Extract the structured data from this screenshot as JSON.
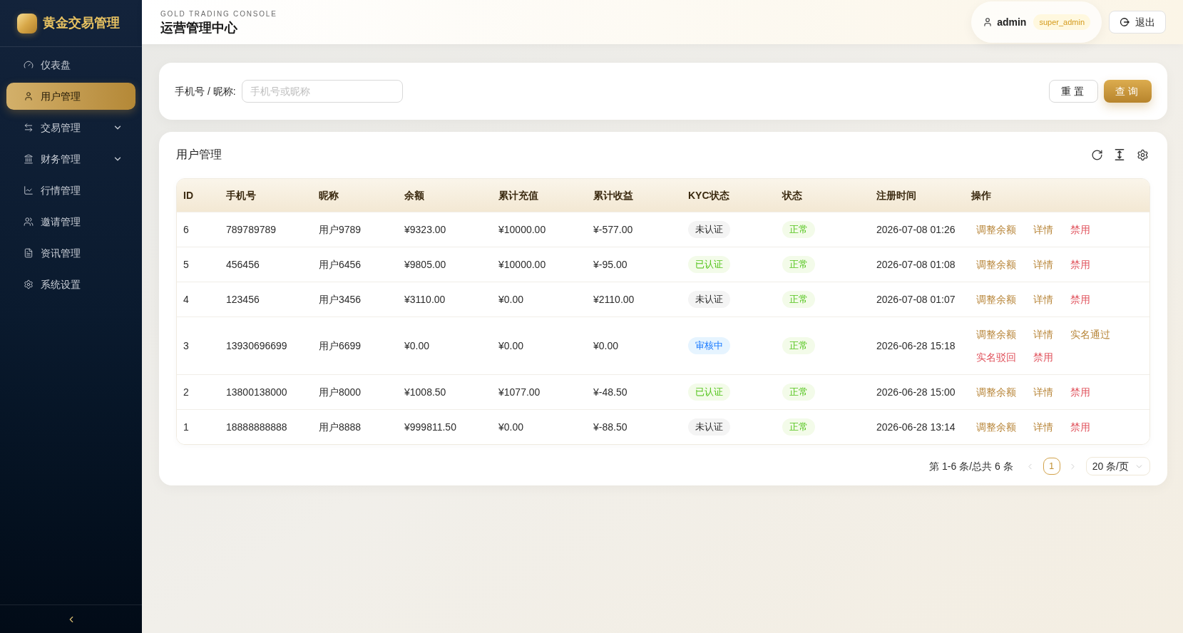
{
  "sidebar": {
    "title": "黄金交易管理",
    "items": [
      {
        "label": "仪表盘",
        "selected": false,
        "expandable": false
      },
      {
        "label": "用户管理",
        "selected": true,
        "expandable": false
      },
      {
        "label": "交易管理",
        "selected": false,
        "expandable": true
      },
      {
        "label": "财务管理",
        "selected": false,
        "expandable": true
      },
      {
        "label": "行情管理",
        "selected": false,
        "expandable": false
      },
      {
        "label": "邀请管理",
        "selected": false,
        "expandable": false
      },
      {
        "label": "资讯管理",
        "selected": false,
        "expandable": false
      },
      {
        "label": "系统设置",
        "selected": false,
        "expandable": false
      }
    ]
  },
  "header": {
    "subtitle": "GOLD TRADING CONSOLE",
    "title": "运营管理中心",
    "user": {
      "name": "admin",
      "role": "super_admin"
    },
    "logout": "退出"
  },
  "filter": {
    "label": "手机号 / 昵称:",
    "placeholder": "手机号或昵称",
    "buttons": [
      {
        "label": "重置",
        "primary": false
      },
      {
        "label": "查询",
        "primary": true
      }
    ]
  },
  "table": {
    "title": "用户管理",
    "columns": [
      "ID",
      "手机号",
      "昵称",
      "余额",
      "累计充值",
      "累计收益",
      "KYC状态",
      "状态",
      "注册时间",
      "操作"
    ],
    "rows": [
      {
        "id": "6",
        "phone": "789789789",
        "nickname": "用户9789",
        "balance": "¥9323.00",
        "total_recharge": "¥10000.00",
        "total_income": "¥-577.00",
        "kyc": {
          "label": "未认证",
          "kind": "unverified"
        },
        "status": {
          "label": "正常",
          "kind": "normal"
        },
        "registered_at": "2026-07-08 01:26",
        "actions": [
          {
            "label": "调整余额",
            "danger": false
          },
          {
            "label": "详情",
            "danger": false
          },
          {
            "label": "禁用",
            "danger": true
          }
        ]
      },
      {
        "id": "5",
        "phone": "456456",
        "nickname": "用户6456",
        "balance": "¥9805.00",
        "total_recharge": "¥10000.00",
        "total_income": "¥-95.00",
        "kyc": {
          "label": "已认证",
          "kind": "verified"
        },
        "status": {
          "label": "正常",
          "kind": "normal"
        },
        "registered_at": "2026-07-08 01:08",
        "actions": [
          {
            "label": "调整余额",
            "danger": false
          },
          {
            "label": "详情",
            "danger": false
          },
          {
            "label": "禁用",
            "danger": true
          }
        ]
      },
      {
        "id": "4",
        "phone": "123456",
        "nickname": "用户3456",
        "balance": "¥3110.00",
        "total_recharge": "¥0.00",
        "total_income": "¥2110.00",
        "kyc": {
          "label": "未认证",
          "kind": "unverified"
        },
        "status": {
          "label": "正常",
          "kind": "normal"
        },
        "registered_at": "2026-07-08 01:07",
        "actions": [
          {
            "label": "调整余额",
            "danger": false
          },
          {
            "label": "详情",
            "danger": false
          },
          {
            "label": "禁用",
            "danger": true
          }
        ]
      },
      {
        "id": "3",
        "phone": "13930696699",
        "nickname": "用户6699",
        "balance": "¥0.00",
        "total_recharge": "¥0.00",
        "total_income": "¥0.00",
        "kyc": {
          "label": "审核中",
          "kind": "pending"
        },
        "status": {
          "label": "正常",
          "kind": "normal"
        },
        "registered_at": "2026-06-28 15:18",
        "actions": [
          {
            "label": "调整余额",
            "danger": false
          },
          {
            "label": "详情",
            "danger": false
          },
          {
            "label": "实名通过",
            "danger": false
          },
          {
            "label": "实名驳回",
            "danger": true
          },
          {
            "label": "禁用",
            "danger": true
          }
        ]
      },
      {
        "id": "2",
        "phone": "13800138000",
        "nickname": "用户8000",
        "balance": "¥1008.50",
        "total_recharge": "¥1077.00",
        "total_income": "¥-48.50",
        "kyc": {
          "label": "已认证",
          "kind": "verified"
        },
        "status": {
          "label": "正常",
          "kind": "normal"
        },
        "registered_at": "2026-06-28 15:00",
        "actions": [
          {
            "label": "调整余额",
            "danger": false
          },
          {
            "label": "详情",
            "danger": false
          },
          {
            "label": "禁用",
            "danger": true
          }
        ]
      },
      {
        "id": "1",
        "phone": "18888888888",
        "nickname": "用户8888",
        "balance": "¥999811.50",
        "total_recharge": "¥0.00",
        "total_income": "¥-88.50",
        "kyc": {
          "label": "未认证",
          "kind": "unverified"
        },
        "status": {
          "label": "正常",
          "kind": "normal"
        },
        "registered_at": "2026-06-28 13:14",
        "actions": [
          {
            "label": "调整余额",
            "danger": false
          },
          {
            "label": "详情",
            "danger": false
          },
          {
            "label": "禁用",
            "danger": true
          }
        ]
      }
    ]
  },
  "pagination": {
    "summary": "第 1-6 条/总共 6 条",
    "prev": {
      "disabled": true
    },
    "pages": [
      {
        "label": "1",
        "selected": true
      }
    ],
    "next": {
      "disabled": true
    },
    "page_size": "20 条/页"
  }
}
